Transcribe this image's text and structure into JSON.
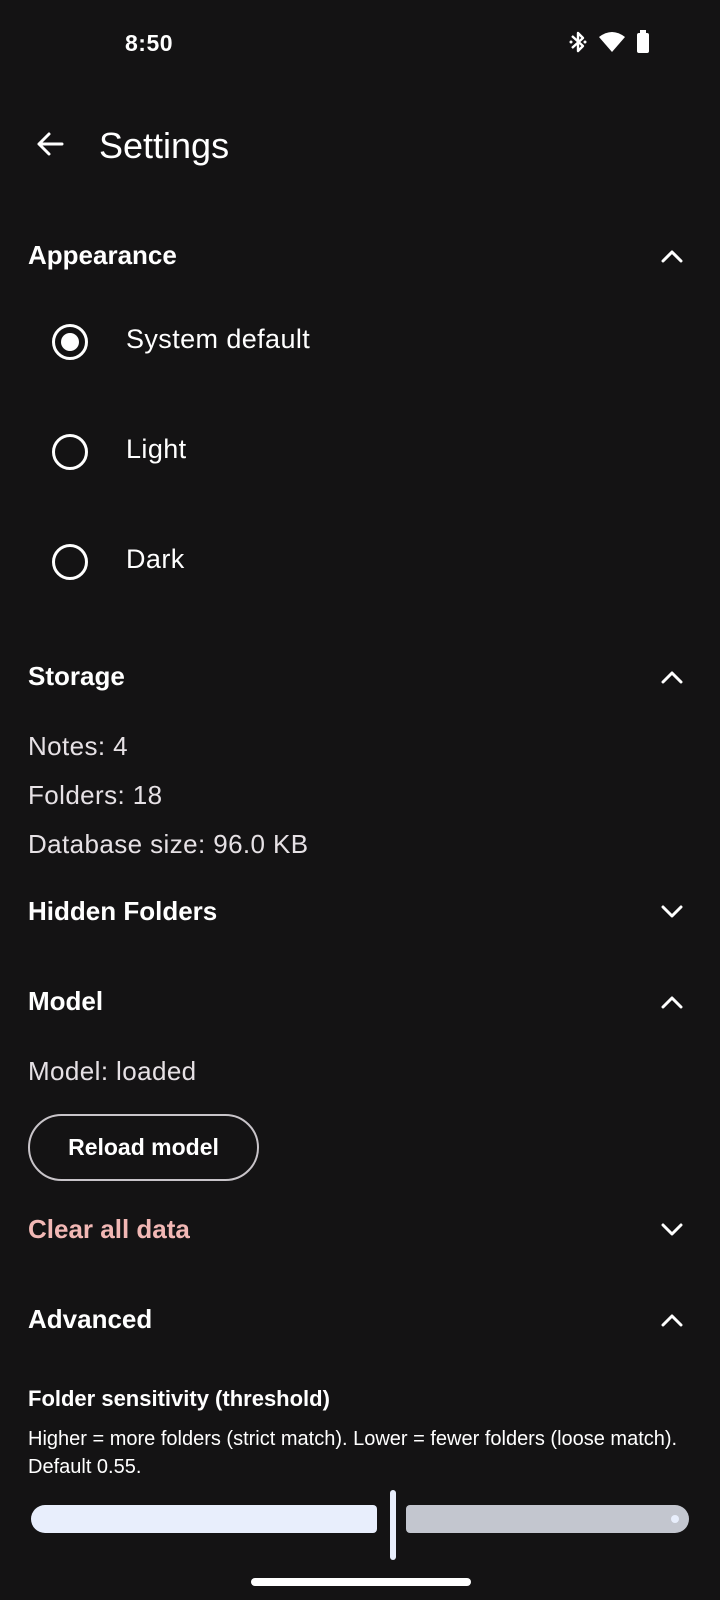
{
  "status_bar": {
    "time": "8:50",
    "icons": [
      "bluetooth-icon",
      "wifi-icon",
      "battery-icon"
    ]
  },
  "app_bar": {
    "title": "Settings",
    "back_icon": "arrow-left-icon"
  },
  "appearance": {
    "title": "Appearance",
    "expanded": true,
    "options": [
      {
        "label": "System default",
        "selected": true
      },
      {
        "label": "Light",
        "selected": false
      },
      {
        "label": "Dark",
        "selected": false
      }
    ]
  },
  "storage": {
    "title": "Storage",
    "expanded": true,
    "notes": "Notes: 4",
    "folders": "Folders: 18",
    "db_size": "Database size: 96.0 KB"
  },
  "hidden_folders": {
    "title": "Hidden Folders",
    "expanded": false
  },
  "model": {
    "title": "Model",
    "expanded": true,
    "status": "Model: loaded",
    "reload_label": "Reload model"
  },
  "clear_data": {
    "title": "Clear all data",
    "expanded": false,
    "color": "#f2b8b5"
  },
  "advanced": {
    "title": "Advanced",
    "expanded": true,
    "threshold_label": "Folder sensitivity (threshold)",
    "threshold_desc": "Higher = more folders (strict match). Lower = fewer folders (loose match). Default 0.55.",
    "slider_fraction": 0.55
  },
  "colors": {
    "background": "#141314",
    "slider_active": "#e8eefc",
    "slider_inactive": "#c3c6cf"
  }
}
